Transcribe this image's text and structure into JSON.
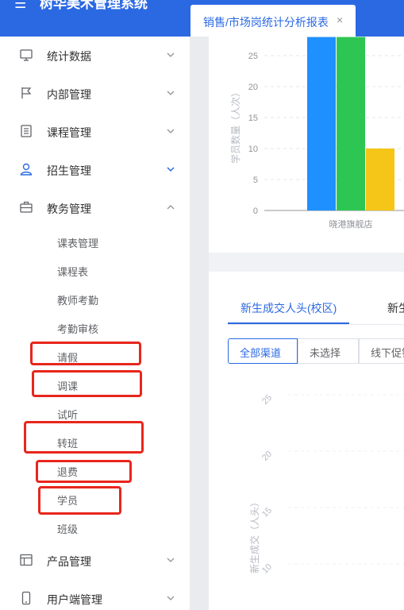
{
  "header": {
    "app_title": "树华美术管理系统",
    "tab_label": "销售/市场岗统计分析报表",
    "tab_close": "×"
  },
  "sidebar": {
    "menus": [
      {
        "label": "统计数据",
        "icon": "monitor-icon",
        "arrow": "chevron-down-icon"
      },
      {
        "label": "内部管理",
        "icon": "flag-icon",
        "arrow": "chevron-down-icon"
      },
      {
        "label": "课程管理",
        "icon": "list-icon",
        "arrow": "chevron-down-icon"
      },
      {
        "label": "招生管理",
        "icon": "user-icon",
        "arrow": "chevron-down-icon"
      },
      {
        "label": "教务管理",
        "icon": "briefcase-icon",
        "arrow": "chevron-up-icon"
      }
    ],
    "sub_items": [
      "课表管理",
      "课程表",
      "教师考勤",
      "考勤审核",
      "请假",
      "调课",
      "试听",
      "转班",
      "退费",
      "学员",
      "班级"
    ],
    "bottom_menus": [
      {
        "label": "产品管理",
        "icon": "layout-icon",
        "arrow": "chevron-down-icon"
      },
      {
        "label": "用户端管理",
        "icon": "phone-icon",
        "arrow": "chevron-down-icon"
      }
    ],
    "highlight_color": "#e8261c",
    "accent_color": "#2b69e3"
  },
  "chart_data": [
    {
      "type": "bar",
      "ylabel": "学员数量（人次）",
      "yticks": [
        "0",
        "5",
        "10",
        "15",
        "20",
        "25"
      ],
      "ylim": [
        0,
        29
      ],
      "categories": [
        "晓港旗舰店"
      ],
      "series": [
        {
          "color": "#1e90ff",
          "values": [
            28
          ]
        },
        {
          "color": "#2dc653",
          "values": [
            28
          ]
        },
        {
          "color": "#f5c518",
          "values": [
            10
          ]
        }
      ]
    },
    {
      "type": "bar",
      "tabs": [
        "新生成交人头(校区)",
        "新生"
      ],
      "filters": [
        "全部渠道",
        "未选择",
        "线下促销"
      ],
      "ylabel": "新生成交（人头）",
      "yticks": [
        "10",
        "15",
        "20",
        "25"
      ]
    }
  ]
}
